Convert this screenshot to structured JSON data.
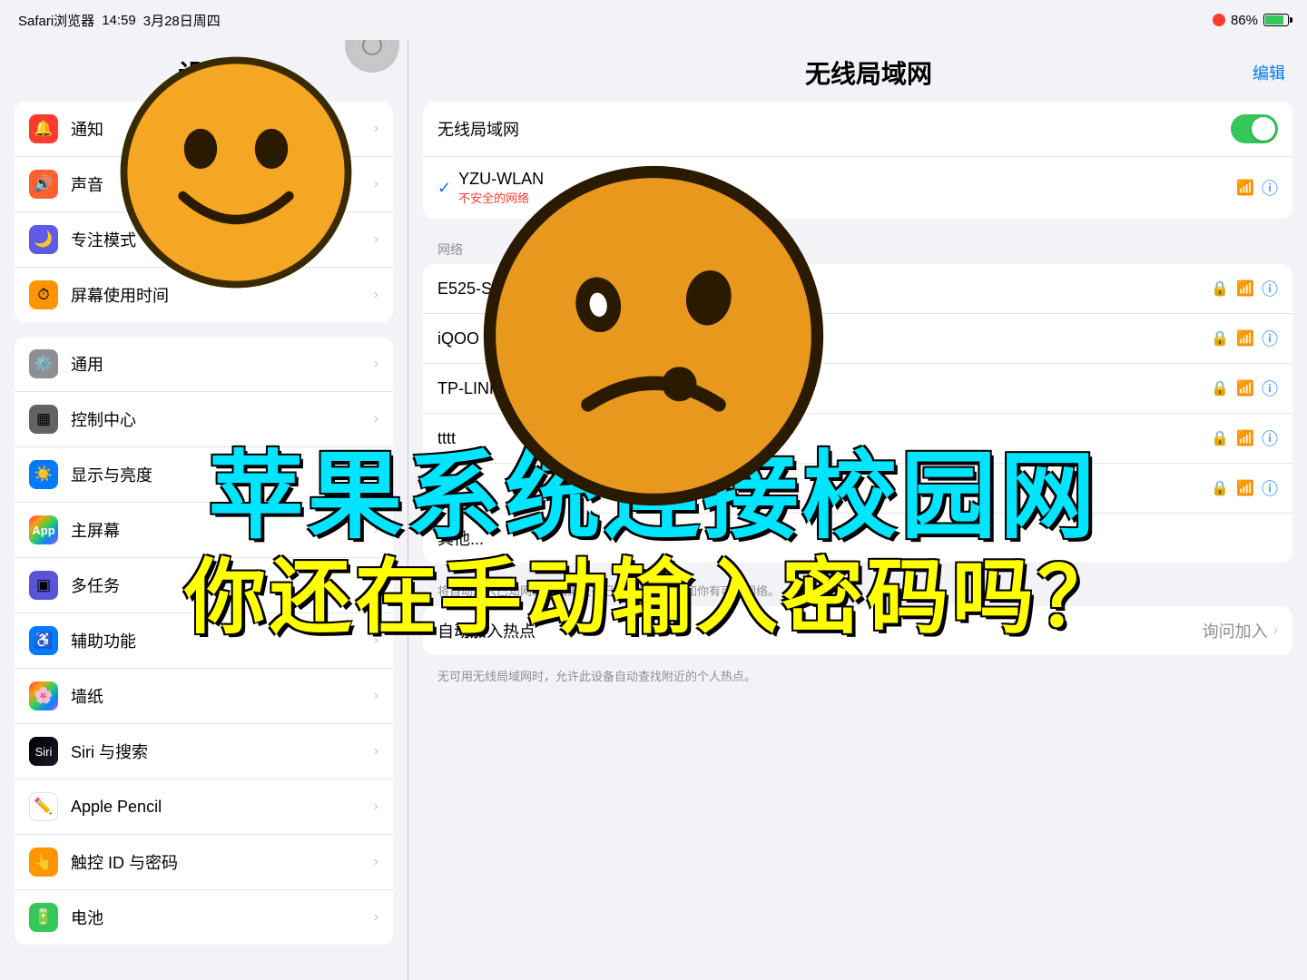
{
  "statusBar": {
    "app": "Safari浏览器",
    "time": "14:59",
    "date": "3月28日周四",
    "batteryPercent": "86%"
  },
  "sidebar": {
    "title": "设置",
    "groups": [
      {
        "items": [
          {
            "id": "notifications",
            "label": "通知",
            "iconColor": "red"
          },
          {
            "id": "sound",
            "label": "声音",
            "iconColor": "orange-red"
          },
          {
            "id": "focus",
            "label": "专注模式",
            "iconColor": "purple"
          },
          {
            "id": "screentime",
            "label": "屏幕使用时间",
            "iconColor": "orange"
          }
        ]
      },
      {
        "items": [
          {
            "id": "general",
            "label": "通用",
            "iconColor": "gray"
          },
          {
            "id": "controlcenter",
            "label": "控制中心",
            "iconColor": "gray2"
          },
          {
            "id": "display",
            "label": "显示与亮度",
            "iconColor": "blue"
          },
          {
            "id": "homescreen",
            "label": "主屏幕",
            "iconColor": "rainbow"
          },
          {
            "id": "multitasking",
            "label": "多任务",
            "iconColor": "blue"
          },
          {
            "id": "accessibility",
            "label": "辅助功能",
            "iconColor": "blue"
          },
          {
            "id": "wallpaper",
            "label": "墙纸",
            "iconColor": "rainbow"
          },
          {
            "id": "siri",
            "label": "Siri 与搜索",
            "iconColor": "siri"
          },
          {
            "id": "pencil",
            "label": "Apple Pencil",
            "iconColor": "pencil"
          },
          {
            "id": "touchid",
            "label": "触控 ID 与密码",
            "iconColor": "fingerprint"
          },
          {
            "id": "battery",
            "label": "电池",
            "iconColor": "battery"
          }
        ]
      }
    ]
  },
  "rightPanel": {
    "title": "无线局域网",
    "editLabel": "编辑",
    "wifiLabel": "无线局域网",
    "connectedNetwork": {
      "name": "YZU-WLAN",
      "sublabel": "不安全的网络"
    },
    "sectionLabel": "网络",
    "networks": [
      {
        "name": "E525-Smart-class",
        "locked": true
      },
      {
        "name": "iQOO Neo5",
        "locked": true
      },
      {
        "name": "TP-LINK_ME",
        "locked": true
      },
      {
        "name": "tttt",
        "locked": true
      },
      {
        "name": "",
        "locked": true
      }
    ],
    "otherNetworksLabel": "其他...",
    "autoAskLabel": "将自动加入已知网络。如果没有已知网络，将通知你有可用网络。",
    "autoHotspotLabel": "自动加入热点",
    "askJoinLabel": "询问加入",
    "hotspotNote": "无可用无线局域网时，允许此设备自动查找附近的个人热点。"
  },
  "overlayText": {
    "line1": "苹果系统连接校园网",
    "line2": "你还在手动输入密码吗？"
  }
}
